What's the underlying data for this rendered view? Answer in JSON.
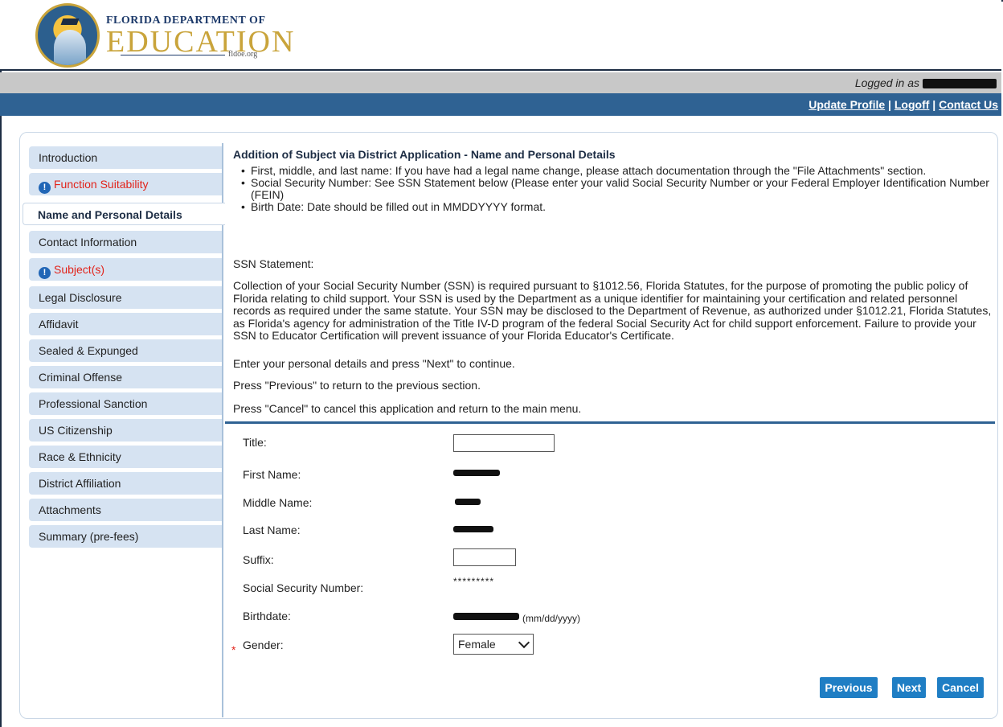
{
  "header": {
    "logo_line1": "FLORIDA DEPARTMENT OF",
    "logo_line2": "EDUCATION",
    "logo_url": "fldoe.org",
    "logged_in_label": "Logged in as",
    "links": {
      "update_profile": "Update Profile",
      "separator": "|",
      "logoff": "Logoff",
      "contact_us": "Contact Us"
    }
  },
  "sidebar": {
    "items": [
      {
        "label": "Introduction",
        "state": "normal"
      },
      {
        "label": "Function Suitability",
        "state": "warning"
      },
      {
        "label": "Name and Personal Details",
        "state": "active"
      },
      {
        "label": "Contact Information",
        "state": "normal"
      },
      {
        "label": "Subject(s)",
        "state": "warning"
      },
      {
        "label": "Legal Disclosure",
        "state": "normal"
      },
      {
        "label": "Affidavit",
        "state": "normal"
      },
      {
        "label": "Sealed & Expunged",
        "state": "normal"
      },
      {
        "label": "Criminal Offense",
        "state": "normal"
      },
      {
        "label": "Professional Sanction",
        "state": "normal"
      },
      {
        "label": "US Citizenship",
        "state": "normal"
      },
      {
        "label": "Race & Ethnicity",
        "state": "normal"
      },
      {
        "label": "District Affiliation",
        "state": "normal"
      },
      {
        "label": "Attachments",
        "state": "normal"
      },
      {
        "label": "Summary (pre-fees)",
        "state": "normal"
      }
    ],
    "warning_icon": "alert-circle-icon"
  },
  "content": {
    "title": "Addition of Subject via District Application - Name and Personal Details",
    "bullets": [
      "First, middle, and last name: If you have had a legal name change, please attach documentation through the \"File Attachments\" section.",
      "Social Security Number: See SSN Statement below (Please enter your valid Social Security Number or your Federal Employer Identification Number (FEIN)",
      "Birth Date: Date should be filled out in MMDDYYYY format."
    ],
    "ssn_heading": "SSN Statement:",
    "ssn_body": "Collection of your Social Security Number (SSN) is required pursuant to §1012.56, Florida Statutes, for the purpose of promoting the public policy of Florida relating to child support. Your SSN is used by the Department as a unique identifier for maintaining your certification and related personnel records as required under the same statute. Your SSN may be disclosed to the Department of Revenue, as authorized under §1012.21, Florida Statutes, as Florida's agency for administration of the Title IV-D program of the federal Social Security Act for child support enforcement. Failure to provide your SSN to Educator Certification will prevent issuance of your Florida Educator's Certificate.",
    "instructions": [
      "Enter your personal details and press \"Next\" to continue.",
      "Press \"Previous\" to return to the previous section.",
      "Press \"Cancel\" to cancel this application and return to the main menu."
    ]
  },
  "form": {
    "title_label": "Title:",
    "title_value": "",
    "first_name_label": "First Name:",
    "middle_name_label": "Middle Name:",
    "last_name_label": "Last Name:",
    "suffix_label": "Suffix:",
    "suffix_value": "",
    "ssn_label": "Social Security Number:",
    "ssn_value": "*********",
    "birthdate_label": "Birthdate:",
    "birthdate_hint": "(mm/dd/yyyy)",
    "gender_label": "Gender:",
    "gender_value": "Female",
    "required_mark": "*"
  },
  "buttons": {
    "previous": "Previous",
    "next": "Next",
    "cancel": "Cancel"
  },
  "colors": {
    "nav_blue": "#2f6293",
    "button_blue": "#1f7ec4",
    "warning_red": "#e2231a",
    "sidebar_bg": "#d6e3f2"
  }
}
